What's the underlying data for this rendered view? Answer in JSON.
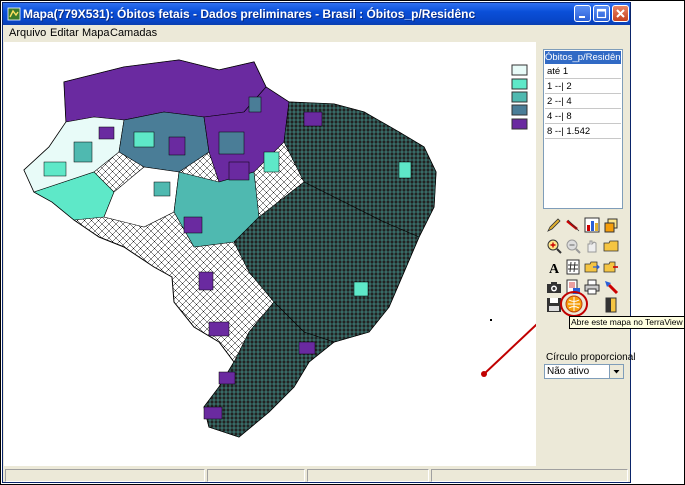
{
  "window": {
    "title": "Mapa(779X531): Óbitos fetais - Dados preliminares - Brasil : Óbitos_p/Residênc",
    "minimize_icon": "minimize-icon",
    "maximize_icon": "maximize-icon",
    "close_icon": "close-icon"
  },
  "menu": [
    "Arquivo",
    "Editar",
    "Mapa",
    "Camadas"
  ],
  "legend": {
    "header": "Óbitos_p/Residênc",
    "rows": [
      "até 1",
      "1 --| 2",
      "2 --| 4",
      "4 --| 8",
      "8 --| 1.542"
    ],
    "colors": [
      "#e8fbf8",
      "#5ee8c8",
      "#4fb9b0",
      "#4a7d97",
      "#6a2aa0"
    ]
  },
  "tools": [
    "pencil-icon",
    "eraser-icon",
    "chart-icon",
    "layers-icon",
    "zoom-in-icon",
    "zoom-out-icon",
    "pan-hand-icon",
    "open-folder-icon",
    "text-icon",
    "hash-grid-icon",
    "move-folder-icon",
    "export-icon",
    "camera-icon",
    "print-setup-icon",
    "printer-icon",
    "pointer-icon",
    "save-icon",
    "terraview-icon",
    "exit-door-icon"
  ],
  "tooltip": "Abre este mapa no TerraView",
  "proportional": {
    "label": "Círculo proporcional",
    "value": "Não ativo"
  }
}
